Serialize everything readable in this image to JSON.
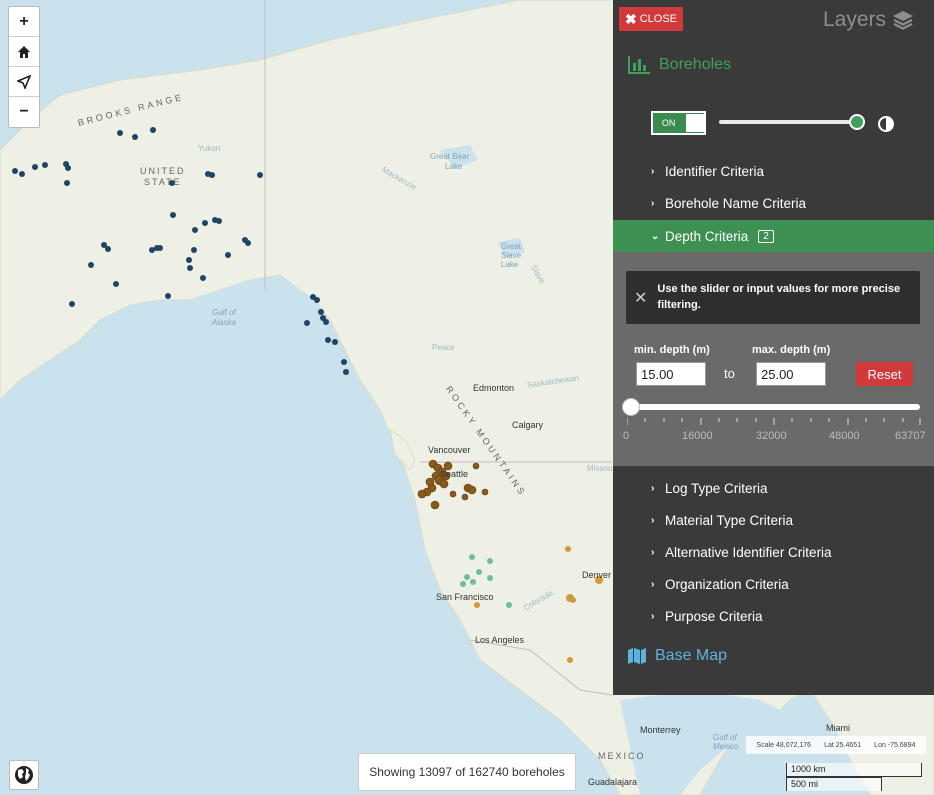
{
  "map": {
    "zoom_in": "+",
    "home_icon": "home-icon",
    "locate_icon": "navigation-arrow-icon",
    "zoom_out": "−",
    "labels": {
      "brooks_range": "BROOKS RANGE",
      "united_states": "UNITED",
      "united_states_2": "STATE",
      "yukon": "Yukon",
      "mackenzie": "Mackenzie",
      "great_bear": "Great Bear",
      "great_bear_2": "Lake",
      "great_slave": "Great",
      "great_slave_2": "Slave",
      "great_slave_3": "Lake",
      "slave": "Slave",
      "gulf_alaska": "Gulf of",
      "gulf_alaska_2": "Alaska",
      "peace": "Peace",
      "edmonton": "Edmonton",
      "saskatchewan": "Saskatchewan",
      "calgary": "Calgary",
      "rocky": "ROCKY MOUNTAINS",
      "vancouver": "Vancouver",
      "seattle": "Seattle",
      "missouri": "Missou",
      "san_francisco": "San Francisco",
      "los_angeles": "Los Angeles",
      "colorado": "Colorado",
      "denver": "Denver",
      "mexico": "MEXICO",
      "monterrey": "Monterrey",
      "guadalajara": "Guadalajara",
      "miami": "Miami",
      "gulf_mexico": "Gulf of",
      "gulf_mexico_2": "Mexico"
    },
    "status": "Showing 13097 of 162740 boreholes",
    "coords": {
      "scale": "Scale 48,072,176",
      "lat": "Lat 25.4651",
      "lon": "Lon -75.6894"
    },
    "scale_km": "1000 km",
    "scale_mi": "500 mi",
    "colors": {
      "ocean": "#c9e2ee",
      "land": "#eef0e6",
      "dot_blue": "#1f4466",
      "dot_brown": "#8a5a1a",
      "dot_orange": "#d29a36",
      "dot_teal": "#6fbd9c"
    }
  },
  "panel": {
    "close_label": "CLOSE",
    "layers_title": "Layers",
    "boreholes_title": "Boreholes",
    "toggle_label": "ON",
    "criteria": [
      {
        "label": "Identifier Criteria"
      },
      {
        "label": "Borehole Name Criteria"
      },
      {
        "label": "Depth Criteria",
        "badge": "2"
      },
      {
        "label": "Log Type Criteria"
      },
      {
        "label": "Material Type Criteria"
      },
      {
        "label": "Alternative Identifier Criteria"
      },
      {
        "label": "Organization Criteria"
      },
      {
        "label": "Purpose Criteria"
      }
    ],
    "depth": {
      "info": "Use the slider or input values for more precise filtering.",
      "min_label": "min. depth (m)",
      "max_label": "max. depth (m)",
      "min_value": "15.00",
      "max_value": "25.00",
      "to": "to",
      "reset": "Reset",
      "ticks": [
        "0",
        "16000",
        "32000",
        "48000",
        "63707"
      ]
    },
    "basemap_title": "Base Map",
    "colors": {
      "accent_green": "#3fa05a",
      "active_row": "#3e8f52",
      "close_red": "#d03a3a",
      "basemap_blue": "#5ab4de"
    }
  }
}
